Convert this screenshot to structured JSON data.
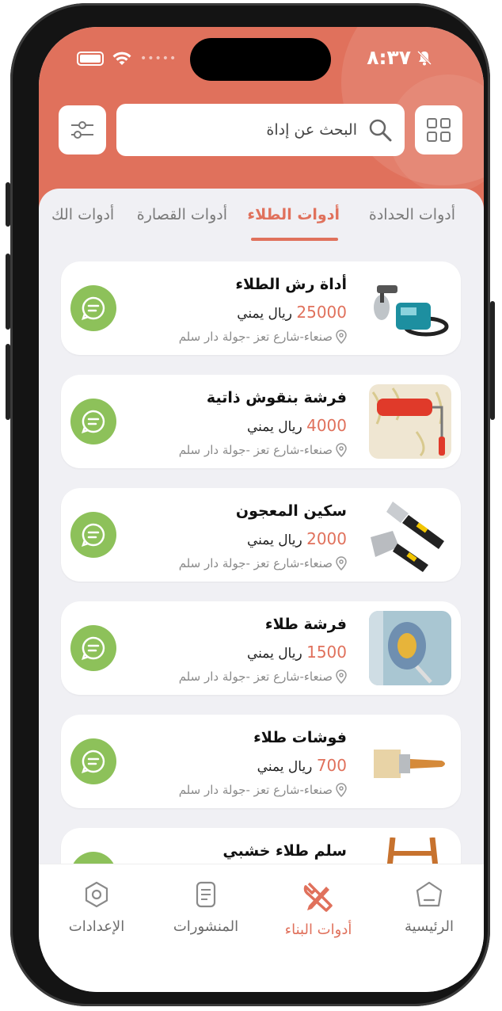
{
  "status_bar": {
    "time": "٨:٣٧"
  },
  "search": {
    "placeholder": "البحث عن إداة"
  },
  "tabs": [
    {
      "label": "أدوات الحدادة"
    },
    {
      "label": "أدوات الطلاء"
    },
    {
      "label": "أدوات القصارة"
    },
    {
      "label": "أدوات الك"
    }
  ],
  "active_tab": "أدوات الطلاء",
  "currency": "ريال يمني",
  "products": [
    {
      "title": "أداة رش الطلاء",
      "price": "25000",
      "currency": "ريال يمني",
      "location": "صنعاء-شارع تعز -جولة دار سلم"
    },
    {
      "title": "فرشة بنقوش ذاتية",
      "price": "4000",
      "currency": "ريال يمني",
      "location": "صنعاء-شارع تعز -جولة دار سلم"
    },
    {
      "title": "سكين المعجون",
      "price": "2000",
      "currency": "ريال يمني",
      "location": "صنعاء-شارع تعز -جولة دار سلم"
    },
    {
      "title": "فرشة طلاء",
      "price": "1500",
      "currency": "ريال يمني",
      "location": "صنعاء-شارع تعز -جولة دار سلم"
    },
    {
      "title": "فوشات طلاء",
      "price": "700",
      "currency": "ريال يمني",
      "location": "صنعاء-شارع تعز -جولة دار سلم"
    },
    {
      "title": "سلم طلاء خشبي"
    }
  ],
  "bottom_nav": [
    {
      "label": "الرئيسية",
      "icon": "home-icon"
    },
    {
      "label": "أدوات البناء",
      "icon": "tools-icon",
      "active": true
    },
    {
      "label": "المنشورات",
      "icon": "posts-icon"
    },
    {
      "label": "الإعدادات",
      "icon": "settings-icon"
    }
  ],
  "colors": {
    "accent": "#e0715c",
    "chat": "#8dc15a",
    "background": "#f0f0f4"
  }
}
